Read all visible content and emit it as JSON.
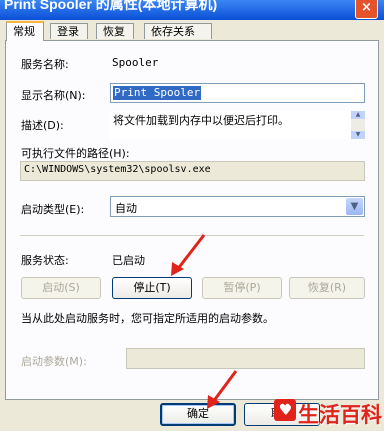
{
  "window": {
    "title": "Print Spooler 的属性(本地计算机)",
    "close_glyph": "×"
  },
  "tabs": [
    {
      "label": "常规",
      "active": true
    },
    {
      "label": "登录",
      "active": false
    },
    {
      "label": "恢复",
      "active": false
    },
    {
      "label": "依存关系",
      "active": false
    }
  ],
  "general": {
    "service_name_label": "服务名称:",
    "service_name_value": "Spooler",
    "display_name_label": "显示名称(N):",
    "display_name_value": "Print Spooler",
    "description_label": "描述(D):",
    "description_value": "将文件加载到内存中以便迟后打印。",
    "exe_path_label": "可执行文件的路径(H):",
    "exe_path_value": "C:\\WINDOWS\\system32\\spoolsv.exe",
    "startup_type_label": "启动类型(E):",
    "startup_type_value": "自动",
    "status_label": "服务状态:",
    "status_value": "已启动",
    "buttons": {
      "start": "启动(S)",
      "stop": "停止(T)",
      "pause": "暂停(P)",
      "resume": "恢复(R)"
    },
    "hint": "当从此处启动服务时，您可指定所适用的启动参数。",
    "start_params_label": "启动参数(M):",
    "start_params_value": ""
  },
  "dialog_buttons": {
    "ok": "确定",
    "cancel": "取消"
  },
  "watermark": {
    "text": "生活百科"
  },
  "colors": {
    "selection": "#316ac5",
    "arrow": "#e0241b",
    "title_bar": "#0a4fd6"
  }
}
